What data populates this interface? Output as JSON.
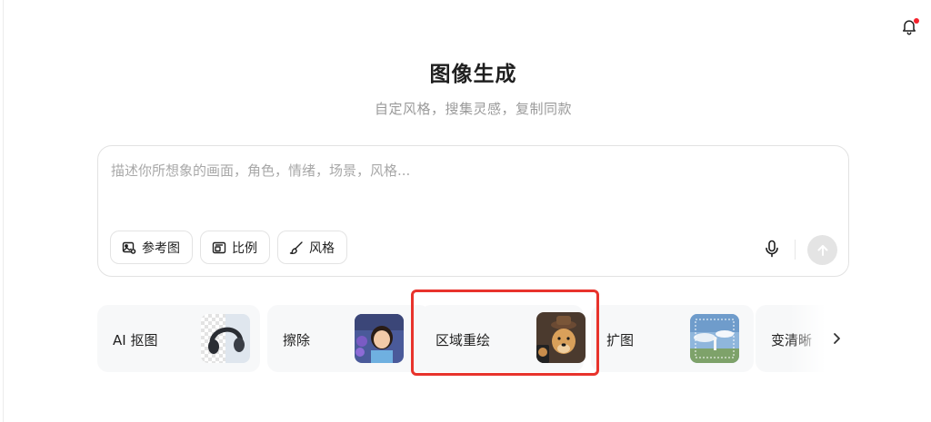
{
  "header": {
    "title": "图像生成",
    "subtitle": "自定风格，搜集灵感，复制同款",
    "notification_icon": "bell-icon",
    "has_unread": true
  },
  "prompt": {
    "placeholder": "描述你所想象的画面，角色，情绪，场景，风格...",
    "value": "",
    "chips": [
      {
        "label": "参考图",
        "icon": "image-add-icon"
      },
      {
        "label": "比例",
        "icon": "aspect-ratio-icon"
      },
      {
        "label": "风格",
        "icon": "brush-icon"
      }
    ],
    "mic_icon": "microphone-icon",
    "send_icon": "arrow-up-icon"
  },
  "tools": [
    {
      "label": "AI 抠图",
      "thumb": "headphones-thumbnail"
    },
    {
      "label": "擦除",
      "thumb": "girl-portrait-thumbnail"
    },
    {
      "label": "区域重绘",
      "thumb": "dog-with-hat-thumbnail"
    },
    {
      "label": "扩图",
      "thumb": "landscape-thumbnail"
    },
    {
      "label": "变清晰",
      "thumb": ""
    }
  ],
  "highlighted_tool": "区域重绘",
  "colors": {
    "highlight": "#e8332c",
    "accent_dot": "#f5222d",
    "card_bg": "#f7f8f9"
  }
}
